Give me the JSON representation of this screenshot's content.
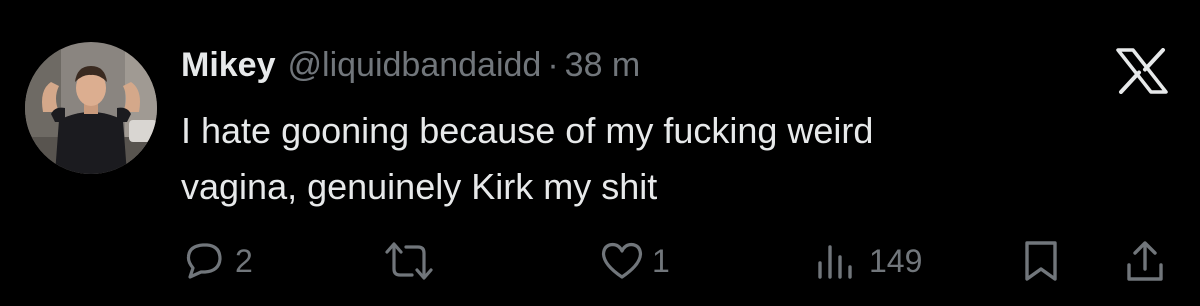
{
  "tweet": {
    "display_name": "Mikey",
    "handle": "@liquidbandaidd",
    "separator": "·",
    "time_ago": "38 m",
    "text_lines": [
      "I hate gooning because of my fucking weird",
      "vagina, genuinely Kirk my shit"
    ]
  },
  "actions": {
    "replies": "2",
    "likes": "1",
    "views": "149"
  },
  "icons": {
    "brand": "x-logo-icon",
    "reply": "reply-icon",
    "retweet": "retweet-icon",
    "like": "heart-icon",
    "views": "views-icon",
    "bookmark": "bookmark-icon",
    "share": "share-icon"
  },
  "colors": {
    "background": "#000000",
    "primary_text": "#e7e9ea",
    "secondary_text": "#71767b"
  }
}
